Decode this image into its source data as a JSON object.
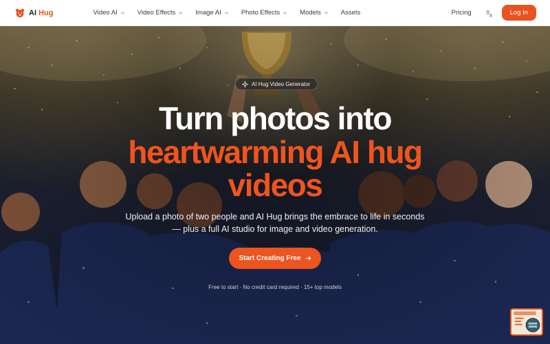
{
  "nav": {
    "logo_prefix": "AI",
    "logo_accent": "Hug",
    "menu": [
      {
        "label": "Video AI",
        "has_dropdown": true
      },
      {
        "label": "Video Effects",
        "has_dropdown": true
      },
      {
        "label": "Image AI",
        "has_dropdown": true
      },
      {
        "label": "Photo Effects",
        "has_dropdown": true
      },
      {
        "label": "Models",
        "has_dropdown": true
      },
      {
        "label": "Assets",
        "has_dropdown": false
      }
    ],
    "pricing": "Pricing",
    "login": "Log In",
    "language_icon": "translate-icon"
  },
  "hero": {
    "badge": "AI Hug Video Generator",
    "headline_line1": "Turn photos into",
    "headline_line2": "heartwarming AI hug",
    "headline_line3": "videos",
    "subtitle": "Upload a photo of two people and AI Hug brings the embrace to life in seconds — plus a full AI studio for image and video generation.",
    "cta": "Start Creating Free",
    "notes": [
      "Free to start",
      "No credit card required",
      "15+ top models"
    ]
  },
  "colors": {
    "accent": "#E9531F",
    "nav_bg": "#FFFFFF",
    "headline_white": "#FFFFFF",
    "headline_accent": "#F0541D"
  }
}
